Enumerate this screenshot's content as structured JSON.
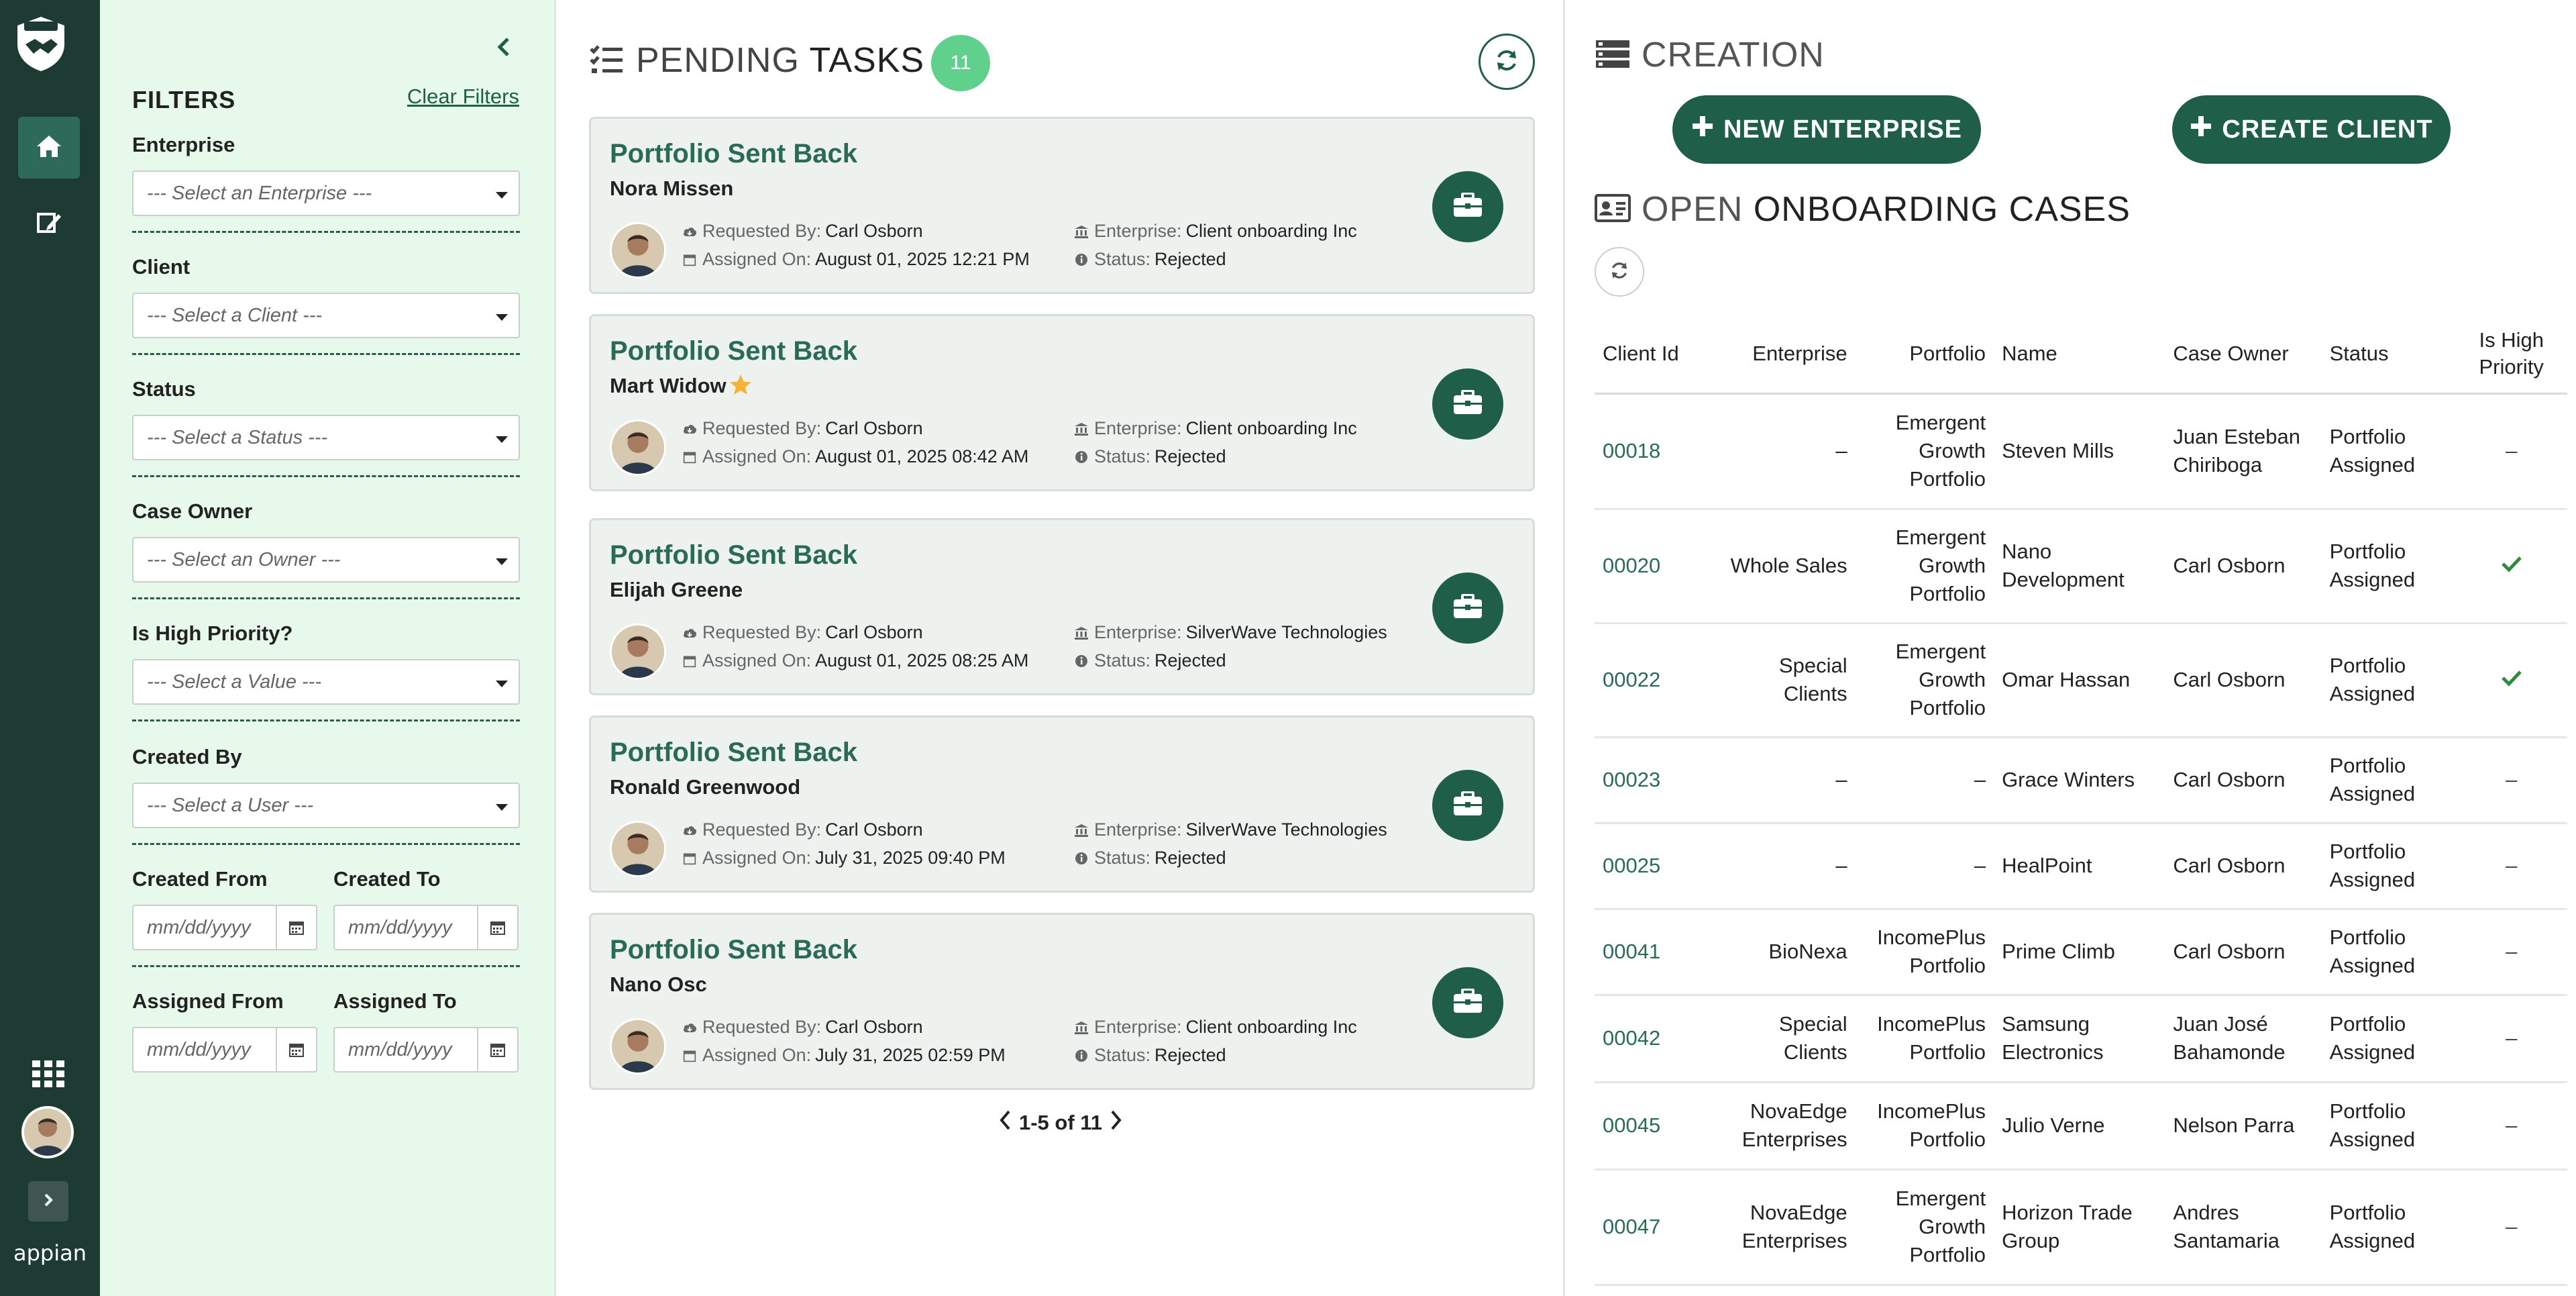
{
  "rail": {
    "brand": "appian",
    "nav": [
      "home-icon",
      "edit-document-icon"
    ],
    "colors": {
      "bg": "#1d3b33",
      "active": "#2e6a5a"
    }
  },
  "filters": {
    "title": "FILTERS",
    "clear_label": "Clear Filters",
    "enterprise": {
      "label": "Enterprise",
      "placeholder": "--- Select an Enterprise ---"
    },
    "client": {
      "label": "Client",
      "placeholder": "--- Select a Client ---"
    },
    "status": {
      "label": "Status",
      "placeholder": "--- Select a Status ---"
    },
    "case_owner": {
      "label": "Case Owner",
      "placeholder": "--- Select an Owner ---"
    },
    "high_priority": {
      "label": "Is High Priority?",
      "placeholder": "--- Select a Value ---"
    },
    "created_by": {
      "label": "Created By",
      "placeholder": "--- Select a User ---"
    },
    "created_from": {
      "label": "Created From",
      "placeholder": "mm/dd/yyyy"
    },
    "created_to": {
      "label": "Created To",
      "placeholder": "mm/dd/yyyy"
    },
    "assigned_from": {
      "label": "Assigned From",
      "placeholder": "mm/dd/yyyy"
    },
    "assigned_to": {
      "label": "Assigned To",
      "placeholder": "mm/dd/yyyy"
    }
  },
  "tasks": {
    "title_light": "PENDING ",
    "title_bold": "TASKS",
    "count": "11",
    "labels": {
      "requested_by": "Requested By:",
      "assigned_on": "Assigned On:",
      "enterprise": "Enterprise:",
      "status": "Status:"
    },
    "items": [
      {
        "title": "Portfolio Sent Back",
        "name": "Nora Missen",
        "star": false,
        "requested_by": "Carl Osborn",
        "assigned_on": "August 01, 2025 12:21 PM",
        "enterprise": "Client onboarding Inc",
        "status": "Rejected"
      },
      {
        "title": "Portfolio Sent Back",
        "name": "Mart Widow",
        "star": true,
        "requested_by": "Carl Osborn",
        "assigned_on": "August 01, 2025 08:42 AM",
        "enterprise": "Client onboarding Inc",
        "status": "Rejected"
      },
      {
        "title": "Portfolio Sent Back",
        "name": "Elijah Greene",
        "star": false,
        "requested_by": "Carl Osborn",
        "assigned_on": "August 01, 2025 08:25 AM",
        "enterprise": "SilverWave Technologies",
        "status": "Rejected"
      },
      {
        "title": "Portfolio Sent Back",
        "name": "Ronald Greenwood",
        "star": false,
        "requested_by": "Carl Osborn",
        "assigned_on": "July 31, 2025 09:40 PM",
        "enterprise": "SilverWave Technologies",
        "status": "Rejected"
      },
      {
        "title": "Portfolio Sent Back",
        "name": "Nano Osc",
        "star": false,
        "requested_by": "Carl Osborn",
        "assigned_on": "July 31, 2025 02:59 PM",
        "enterprise": "Client onboarding Inc",
        "status": "Rejected"
      }
    ],
    "pager": "1-5 of 11"
  },
  "creation": {
    "title": "CREATION",
    "new_enterprise": "NEW ENTERPRISE",
    "create_client": "CREATE CLIENT"
  },
  "cases": {
    "title_light": "OPEN ",
    "title_bold": "ONBOARDING CASES",
    "columns": [
      "Client Id",
      "Enterprise",
      "Portfolio",
      "Name",
      "Case Owner",
      "Status",
      "Is High Priority"
    ],
    "rows": [
      {
        "id": "00018",
        "enterprise": "–",
        "portfolio": "Emergent Growth Portfolio",
        "name": "Steven Mills",
        "owner": "Juan Esteban Chiriboga",
        "status": "Portfolio Assigned",
        "high": false
      },
      {
        "id": "00020",
        "enterprise": "Whole Sales",
        "portfolio": "Emergent Growth Portfolio",
        "name": "Nano Development",
        "owner": "Carl Osborn",
        "status": "Portfolio Assigned",
        "high": true
      },
      {
        "id": "00022",
        "enterprise": "Special Clients",
        "portfolio": "Emergent Growth Portfolio",
        "name": "Omar Hassan",
        "owner": "Carl Osborn",
        "status": "Portfolio Assigned",
        "high": true
      },
      {
        "id": "00023",
        "enterprise": "–",
        "portfolio": "–",
        "name": "Grace Winters",
        "owner": "Carl Osborn",
        "status": "Portfolio Assigned",
        "high": false
      },
      {
        "id": "00025",
        "enterprise": "–",
        "portfolio": "–",
        "name": "HealPoint",
        "owner": "Carl Osborn",
        "status": "Portfolio Assigned",
        "high": false
      },
      {
        "id": "00041",
        "enterprise": "BioNexa",
        "portfolio": "IncomePlus Portfolio",
        "name": "Prime Climb",
        "owner": "Carl Osborn",
        "status": "Portfolio Assigned",
        "high": false
      },
      {
        "id": "00042",
        "enterprise": "Special Clients",
        "portfolio": "IncomePlus Portfolio",
        "name": "Samsung Electronics",
        "owner": "Juan José Bahamonde",
        "status": "Portfolio Assigned",
        "high": false
      },
      {
        "id": "00045",
        "enterprise": "NovaEdge Enterprises",
        "portfolio": "IncomePlus Portfolio",
        "name": "Julio Verne",
        "owner": "Nelson Parra",
        "status": "Portfolio Assigned",
        "high": false
      },
      {
        "id": "00047",
        "enterprise": "NovaEdge Enterprises",
        "portfolio": "Emergent Growth Portfolio",
        "name": "Horizon Trade Group",
        "owner": "Andres Santamaria",
        "status": "Portfolio Assigned",
        "high": false
      }
    ],
    "dash": "–"
  }
}
